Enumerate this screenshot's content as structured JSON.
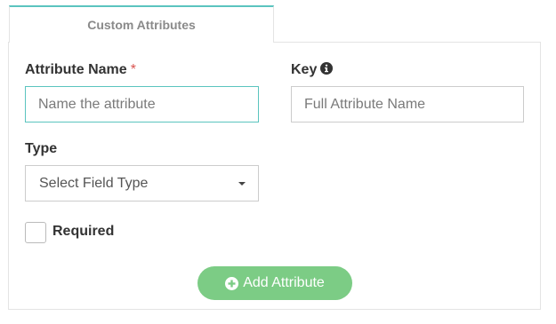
{
  "tab": {
    "label": "Custom Attributes"
  },
  "form": {
    "attribute_name": {
      "label": "Attribute Name",
      "required_marker": "*",
      "placeholder": "Name the attribute"
    },
    "key": {
      "label": "Key",
      "icon": "info-icon",
      "placeholder": "Full Attribute Name"
    },
    "type": {
      "label": "Type",
      "selected": "Select Field Type"
    },
    "required": {
      "label": "Required",
      "checked": false
    },
    "add_button": {
      "label": "Add Attribute",
      "icon": "plus-circle-icon"
    }
  },
  "colors": {
    "accent": "#5bc4bf",
    "button": "#7ccc85",
    "required_star": "#d9534f"
  }
}
